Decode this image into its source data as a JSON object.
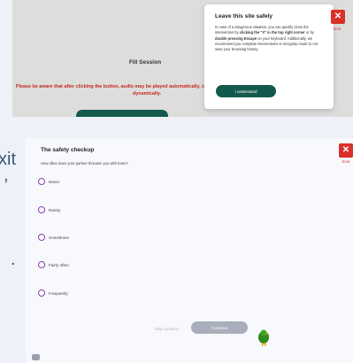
{
  "top_screenshot": {
    "session_title": "Fill Session",
    "warning_text": "Please be aware that after clicking the button, audio may be played automatically, content could change its position dynamically.",
    "modal": {
      "title": "Leave this site safely",
      "body_1": "In case of a dangerous situation, you can quickly close the intervention by ",
      "body_bold_1": "clicking the \"X\" in the top right corner",
      "body_2": " or by ",
      "body_bold_2": "double pressing Escape",
      "body_3": " on your keyboard. Additionally, we recommend you complete interventions in incognito mode to not save your browsing history.",
      "button_label": "I understand"
    },
    "exit": {
      "icon": "close-icon",
      "label": "Exit"
    }
  },
  "left_fragment": {
    "lines": [
      "xit",
      ",",
      "",
      "."
    ]
  },
  "bottom_screenshot": {
    "title": "The safety checkup",
    "question": "How often does your partner threaten you with harm?",
    "options": [
      "Never",
      "Rarely",
      "Sometimes",
      "Fairly often",
      "Frequently"
    ],
    "skip_label": "Skip question",
    "continue_label": "Continue",
    "exit": {
      "icon": "close-icon",
      "label": "Exit"
    },
    "chat_icon": "chat-icon",
    "cursor_icon": "bird-cursor-icon"
  },
  "colors": {
    "exit_red": "#d9302a",
    "brand_green": "#14594e",
    "radio_purple": "#8a3bb0",
    "warning_red": "#c42a1e",
    "continue_disabled": "#a9aebb"
  }
}
